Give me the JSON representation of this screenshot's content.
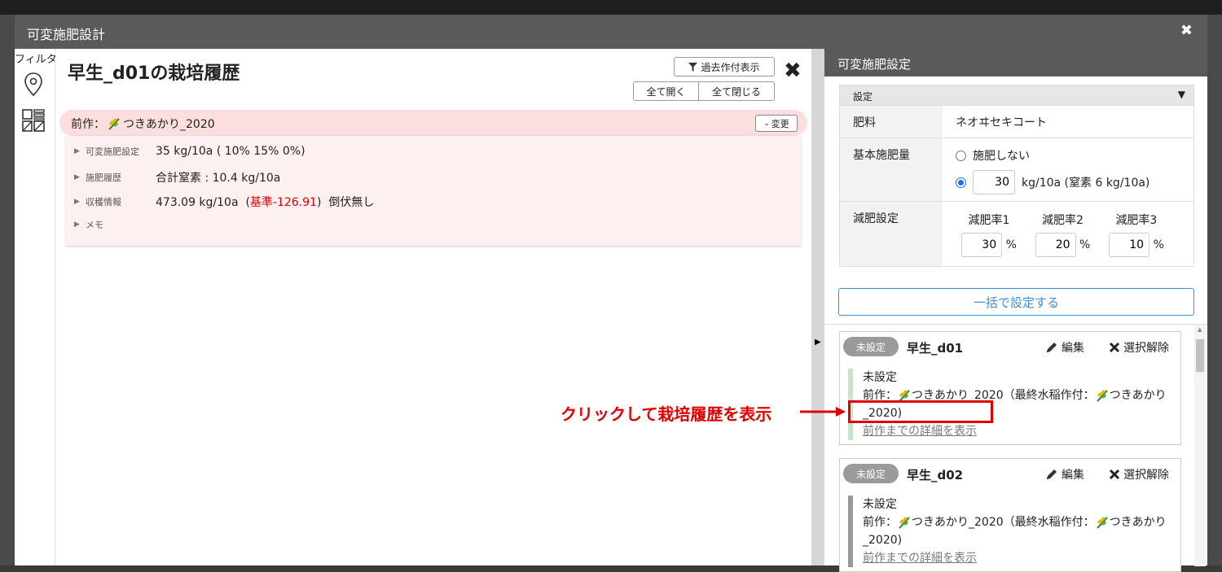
{
  "modal": {
    "title": "可変施肥設計",
    "close_glyph": "✖"
  },
  "sidebar": {
    "filter_label": "フィルタ"
  },
  "main": {
    "title": "早生_d01の栽培履歴",
    "past_button": "過去作付表示",
    "open_all": "全て開く",
    "close_all": "全て閉じる",
    "close_glyph": "✖",
    "prev": {
      "label": "前作：",
      "crop": "つきあかり_2020",
      "change_button": "変更"
    },
    "details": [
      {
        "key": "可変施肥設定",
        "value": "35 kg/10a ( 10% 15% 0%)"
      },
      {
        "key": "施肥履歴",
        "value": "合計窒素 : 10.4 kg/10a"
      },
      {
        "key": "収穫情報",
        "value_pre": "473.09 kg/10a  (",
        "value_red": "基準-126.91",
        "value_post": ")  倒伏無し"
      },
      {
        "key": "メモ",
        "value": ""
      }
    ]
  },
  "right": {
    "title": "可変施肥設定",
    "settings_label": "設定",
    "fertilizer_key": "肥料",
    "fertilizer_value": "ネオヰセキコート",
    "base_key": "基本施肥量",
    "no_fert_label": "施肥しない",
    "base_amount": "30",
    "base_unit": "kg/10a (窒素 6 kg/10a)",
    "reduce_key": "減肥設定",
    "rates": [
      {
        "label": "減肥率1",
        "value": "30",
        "unit": "%"
      },
      {
        "label": "減肥率2",
        "value": "20",
        "unit": "%"
      },
      {
        "label": "減肥率3",
        "value": "10",
        "unit": "%"
      }
    ],
    "bulk_button": "一括で設定する",
    "cards": [
      {
        "badge": "未設定",
        "name": "早生_d01",
        "edit": "編集",
        "deselect": "選択解除",
        "status": "未設定",
        "prev_prefix": "前作：",
        "prev_crop": "つきあかり_2020（最終水稲作付：",
        "prev_crop2": "つきあかり_2020)",
        "link": "前作までの詳細を表示"
      },
      {
        "badge": "未設定",
        "name": "早生_d02",
        "edit": "編集",
        "deselect": "選択解除",
        "status": "未設定",
        "prev_prefix": "前作：",
        "prev_crop": "つきあかり_2020（最終水稲作付：",
        "prev_crop2": "つきあかり_2020)",
        "link": "前作までの詳細を表示"
      }
    ]
  },
  "annotation": {
    "text": "クリックして栽培履歴を表示"
  },
  "colors": {
    "accent_blue": "#3b8fd8",
    "highlight_red": "#e00000",
    "pink_bg": "#fddede"
  }
}
